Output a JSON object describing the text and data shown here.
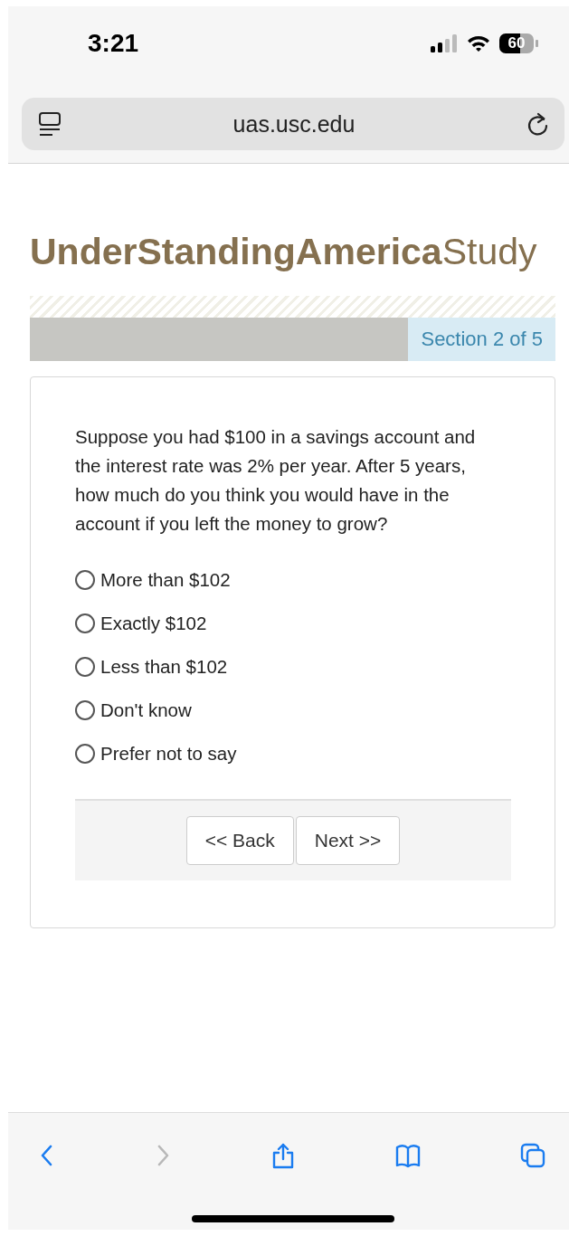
{
  "status_bar": {
    "time": "3:21",
    "battery": "60"
  },
  "address_bar": {
    "url": "uas.usc.edu"
  },
  "logo": {
    "bold": "UnderStandingAmerica",
    "light": "Study"
  },
  "progress": {
    "label": "Section 2 of 5",
    "level": 0.72
  },
  "question": "Suppose you had $100 in a savings account and the interest rate was 2% per year. After 5 years, how much do you think you would have in the account if you left the money to grow?",
  "options": [
    {
      "label": "More than $102",
      "selected": false
    },
    {
      "label": "Exactly $102",
      "selected": false
    },
    {
      "label": "Less than $102",
      "selected": false
    },
    {
      "label": "Don't know",
      "selected": false
    },
    {
      "label": "Prefer not to say",
      "selected": false
    }
  ],
  "buttons": [
    {
      "label": "<< Back"
    },
    {
      "label": "Next >>"
    }
  ],
  "toolbar": [
    {
      "kind": "back",
      "disabled": false
    },
    {
      "kind": "forward",
      "disabled": true
    },
    {
      "kind": "share",
      "disabled": false
    },
    {
      "kind": "bookmarks",
      "disabled": false
    },
    {
      "kind": "tabs",
      "disabled": false
    }
  ]
}
